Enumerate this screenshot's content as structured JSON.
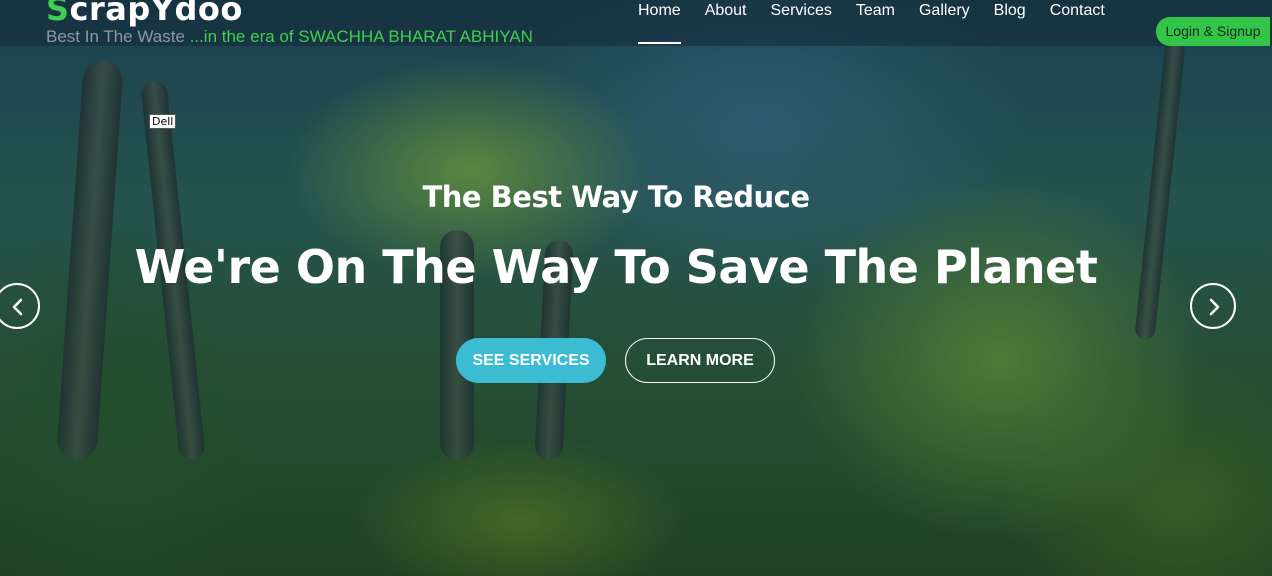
{
  "header": {
    "logo_first": "S",
    "logo_rest": "crapYdoo",
    "tagline_muted": "Best In The Waste",
    "tagline_green": " ...in the era of SWACHHA BHARAT ABHIYAN",
    "login_label": "Login & Signup"
  },
  "nav": {
    "items": [
      "Home",
      "About",
      "Services",
      "Team",
      "Gallery",
      "Blog",
      "Contact"
    ],
    "active": "Home"
  },
  "tooltip": "Dell",
  "hero": {
    "subtitle": "The Best Way To Reduce",
    "title": "We're On The Way To Save The Planet",
    "primary_button": "SEE SERVICES",
    "secondary_button": "LEARN MORE"
  },
  "icons": {
    "prev": "chevron-left-icon",
    "next": "chevron-right-icon",
    "cursor": "mouse-pointer-icon"
  },
  "colors": {
    "brand_green": "#3ecf4e",
    "login_green": "#32c54a",
    "services_button": "#3bbcd3"
  }
}
